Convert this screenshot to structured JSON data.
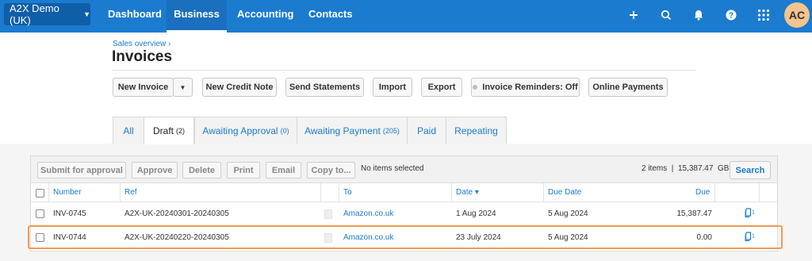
{
  "nav": {
    "org": "A2X Demo (UK)",
    "links": [
      "Dashboard",
      "Business",
      "Accounting",
      "Contacts"
    ],
    "active": "Business",
    "icons": [
      "plus-icon",
      "search-icon",
      "bell-icon",
      "help-icon",
      "apps-grid-icon"
    ],
    "avatar": "AC",
    "brand_color": "#1b7bcf",
    "avatar_color": "#f5c38e"
  },
  "header": {
    "breadcrumb": "Sales overview ›",
    "title": "Invoices"
  },
  "actions": {
    "new_invoice": "New Invoice",
    "new_credit_note": "New Credit Note",
    "send_statements": "Send Statements",
    "import": "Import",
    "export": "Export",
    "reminders": "Invoice Reminders: Off",
    "online_payments": "Online Payments"
  },
  "tabs": [
    {
      "label": "All",
      "count": ""
    },
    {
      "label": "Draft",
      "count": "(2)"
    },
    {
      "label": "Awaiting Approval",
      "count": "(0)"
    },
    {
      "label": "Awaiting Payment",
      "count": "(205)"
    },
    {
      "label": "Paid",
      "count": ""
    },
    {
      "label": "Repeating",
      "count": ""
    }
  ],
  "active_tab": "Draft",
  "toolbar": {
    "submit": "Submit for approval",
    "approve": "Approve",
    "delete": "Delete",
    "print": "Print",
    "email": "Email",
    "copy": "Copy to...",
    "no_items": "No items selected",
    "summary": "2 items  |  15,387.47  GBP",
    "search": "Search"
  },
  "table": {
    "columns": {
      "number": "Number",
      "ref": "Ref",
      "to": "To",
      "date": "Date ▾",
      "due_date": "Due Date",
      "due": "Due"
    },
    "rows": [
      {
        "number": "INV-0745",
        "ref": "A2X-UK-20240301-20240305",
        "to": "Amazon.co.uk",
        "date": "1 Aug 2024",
        "due_date": "5 Aug 2024",
        "due": "15,387.47",
        "files": "1"
      },
      {
        "number": "INV-0744",
        "ref": "A2X-UK-20240220-20240305",
        "to": "Amazon.co.uk",
        "date": "23 July 2024",
        "due_date": "5 Aug 2024",
        "due": "0.00",
        "files": "1"
      }
    ],
    "highlight_color": "#f59a53"
  }
}
